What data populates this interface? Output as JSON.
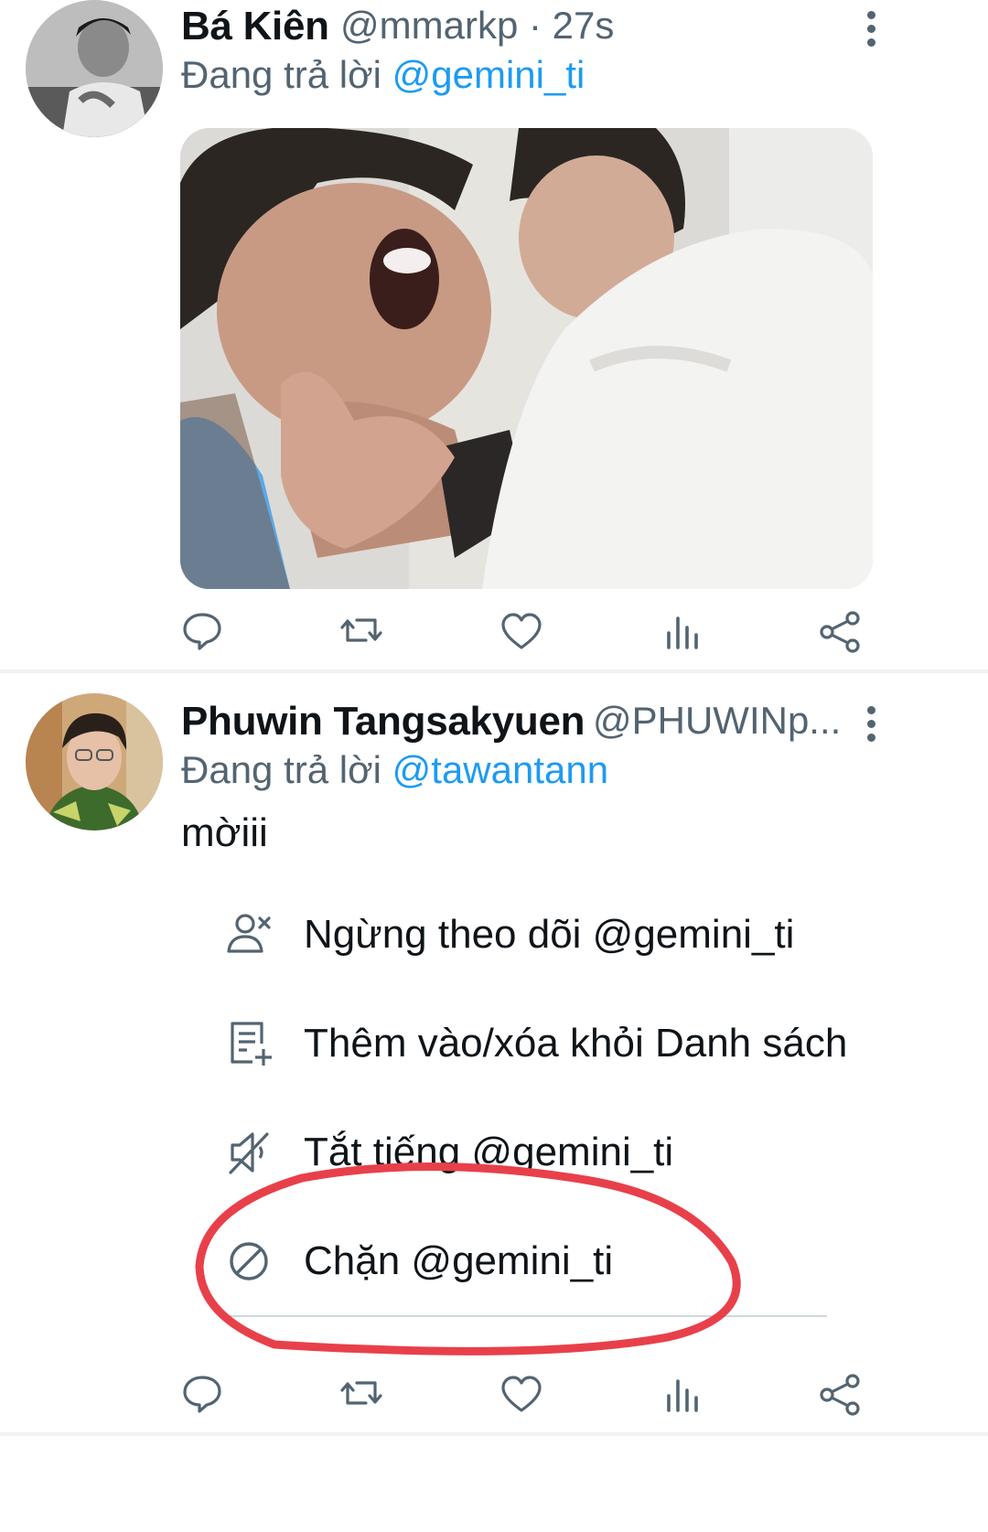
{
  "tweets": [
    {
      "display_name": "Bá Kiên",
      "handle": "@mmarkp",
      "separator": "·",
      "time": "27s",
      "replying_prefix": "Đang trả lời",
      "replying_to": "@gemini_ti"
    },
    {
      "display_name": "Phuwin Tangsakyuen",
      "handle": "@PHUWINp...",
      "replying_prefix": "Đang trả lời",
      "replying_to": "@tawantann",
      "text": "mờiii"
    }
  ],
  "menu": {
    "items": [
      {
        "label": "Ngừng theo dõi @gemini_ti",
        "icon": "unfollow-user-icon"
      },
      {
        "label": "Thêm vào/xóa khỏi Danh sách",
        "icon": "list-add-icon"
      },
      {
        "label": "Tắt tiếng @gemini_ti",
        "icon": "mute-speaker-icon"
      },
      {
        "label": "Chặn @gemini_ti",
        "icon": "block-icon"
      }
    ]
  },
  "colors": {
    "accent": "#1d9bf0",
    "secondary_text": "#536471",
    "annotation_circle": "#e8404a"
  },
  "action_icons": [
    "reply-icon",
    "retweet-icon",
    "like-icon",
    "views-icon",
    "share-icon"
  ]
}
